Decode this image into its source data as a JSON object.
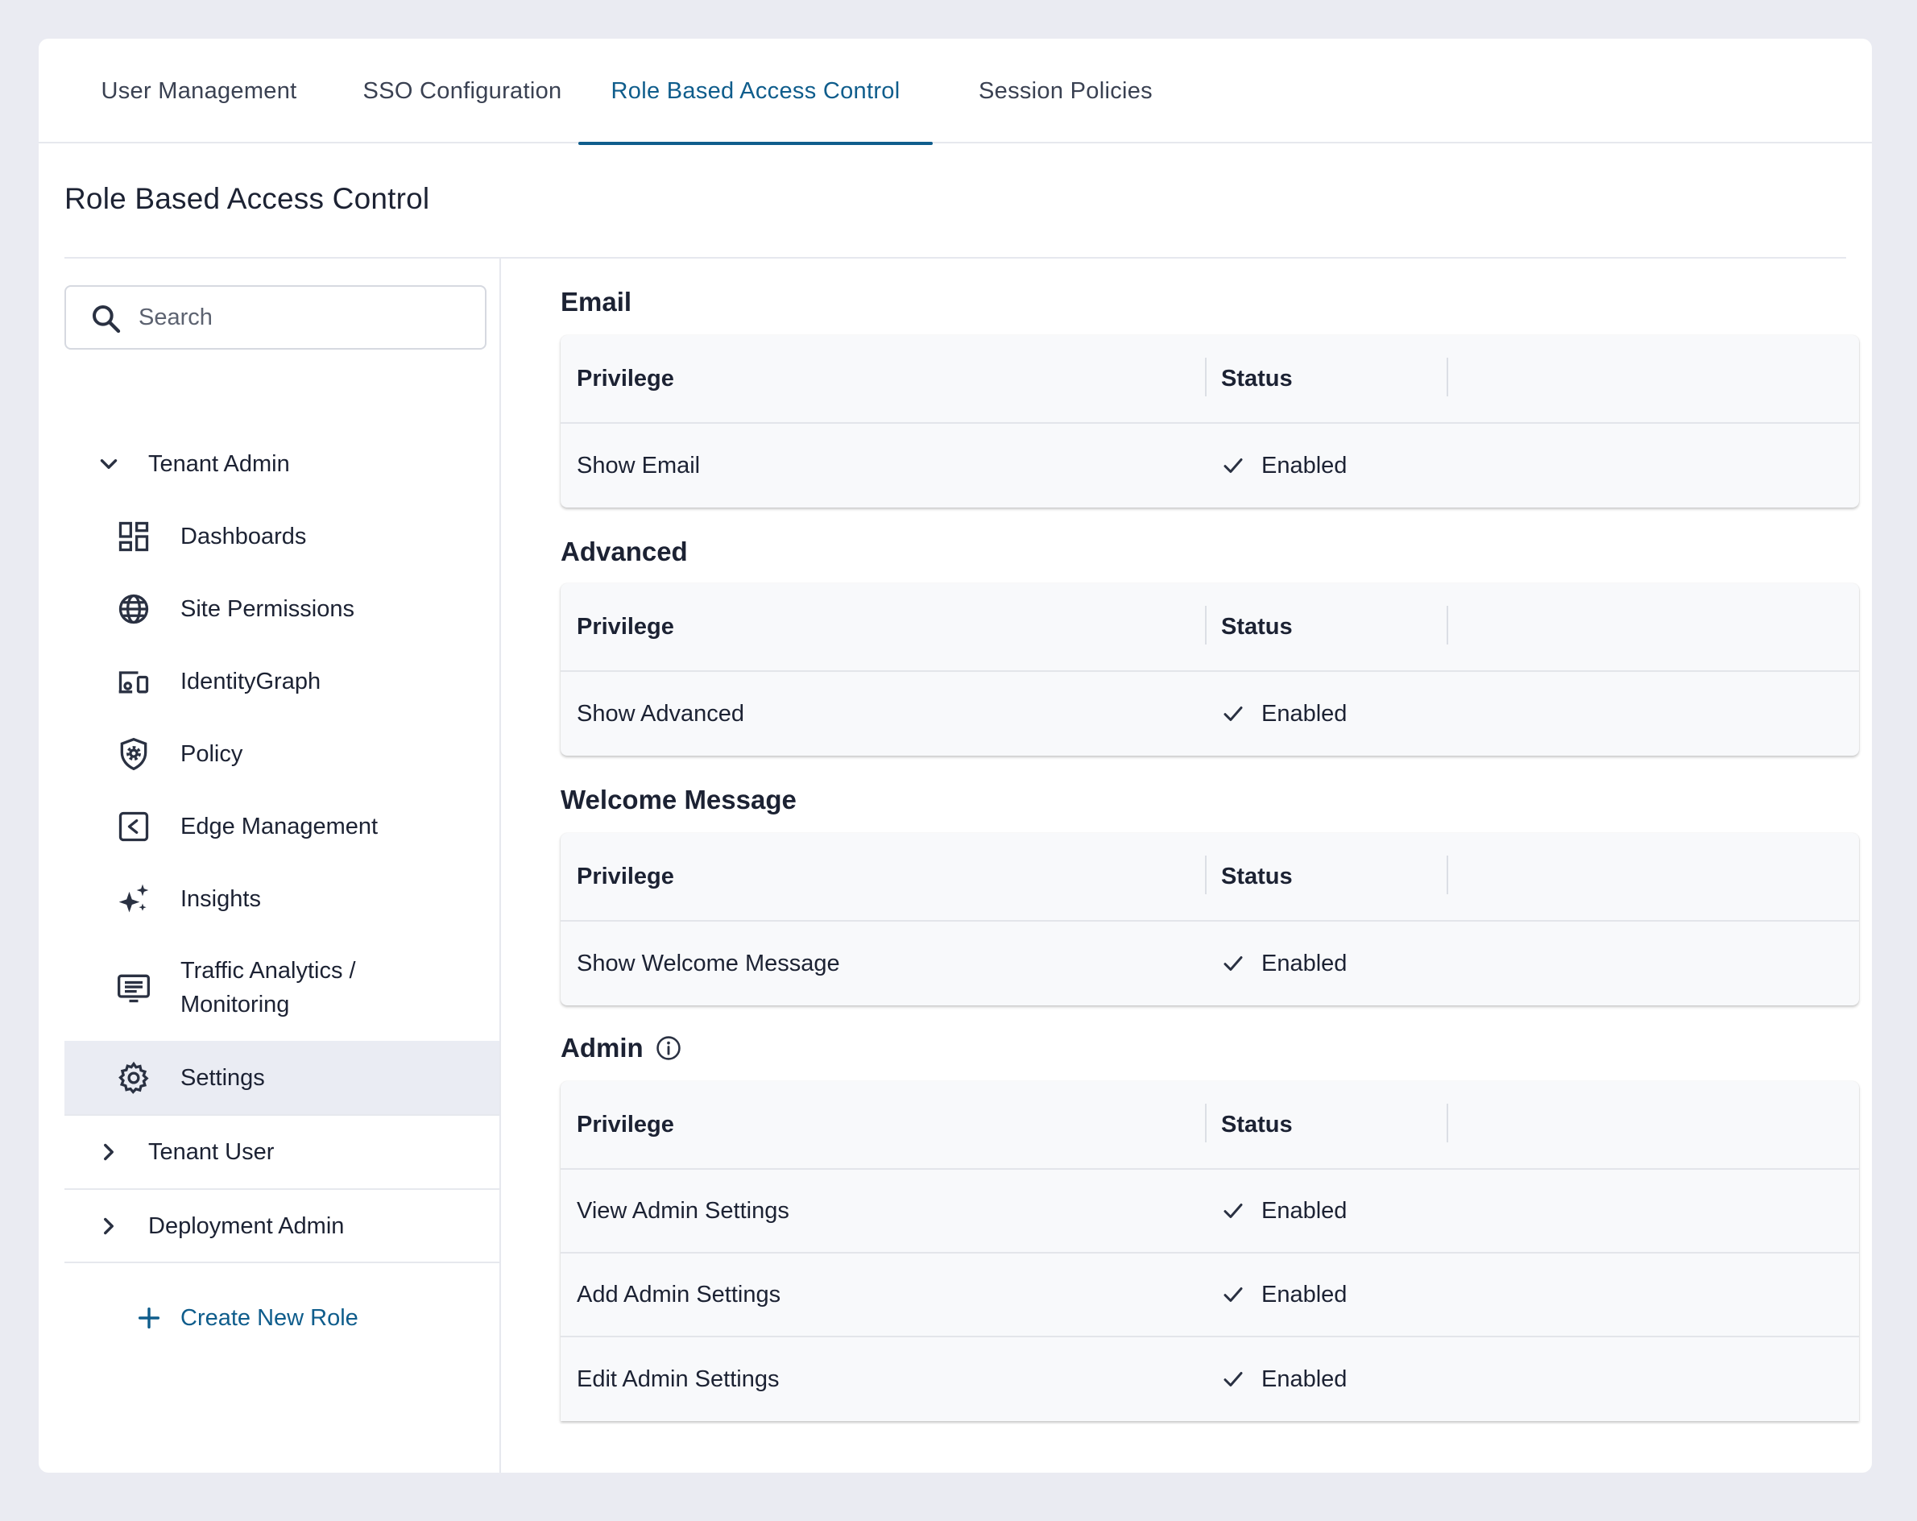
{
  "tabs": [
    {
      "label": "User Management"
    },
    {
      "label": "SSO Configuration"
    },
    {
      "label": "Role Based Access Control"
    },
    {
      "label": "Session Policies"
    }
  ],
  "active_tab": "Role Based Access Control",
  "page_title": "Role Based Access Control",
  "search": {
    "placeholder": "Search",
    "icon": "search-icon"
  },
  "sidebar": {
    "tenant_admin": {
      "label": "Tenant Admin",
      "expanded": true,
      "items": [
        {
          "label": "Dashboards",
          "icon": "dashboard-icon"
        },
        {
          "label": "Site Permissions",
          "icon": "globe-icon"
        },
        {
          "label": "IdentityGraph",
          "icon": "devices-icon"
        },
        {
          "label": "Policy",
          "icon": "shield-gear-icon"
        },
        {
          "label": "Edge Management",
          "icon": "edge-icon"
        },
        {
          "label": "Insights",
          "icon": "sparkle-icon"
        },
        {
          "label": "Traffic Analytics /",
          "label2": "Monitoring",
          "icon": "monitor-icon"
        },
        {
          "label": "Settings",
          "icon": "gear-icon",
          "selected": true
        }
      ]
    },
    "tenant_user": {
      "label": "Tenant User"
    },
    "deployment_admin": {
      "label": "Deployment Admin"
    },
    "create_role": "Create New Role"
  },
  "sections": {
    "email": {
      "title": "Email",
      "header": {
        "privilege": "Privilege",
        "status": "Status"
      },
      "rows": [
        {
          "privilege": "Show Email",
          "status": "Enabled"
        }
      ]
    },
    "advanced": {
      "title": "Advanced",
      "header": {
        "privilege": "Privilege",
        "status": "Status"
      },
      "rows": [
        {
          "privilege": "Show Advanced",
          "status": "Enabled"
        }
      ]
    },
    "welcome": {
      "title": "Welcome Message",
      "header": {
        "privilege": "Privilege",
        "status": "Status"
      },
      "rows": [
        {
          "privilege": "Show Welcome Message",
          "status": "Enabled"
        }
      ]
    },
    "admin": {
      "title": "Admin",
      "header": {
        "privilege": "Privilege",
        "status": "Status"
      },
      "rows": [
        {
          "privilege": "View Admin Settings",
          "status": "Enabled"
        },
        {
          "privilege": "Add Admin Settings",
          "status": "Enabled"
        },
        {
          "privilege": "Edit Admin Settings",
          "status": "Enabled"
        }
      ]
    }
  },
  "colors": {
    "accent": "#0f5d8c",
    "background": "#eaebf2",
    "text": "#1c2233",
    "selected_bg": "#eaecf3"
  }
}
